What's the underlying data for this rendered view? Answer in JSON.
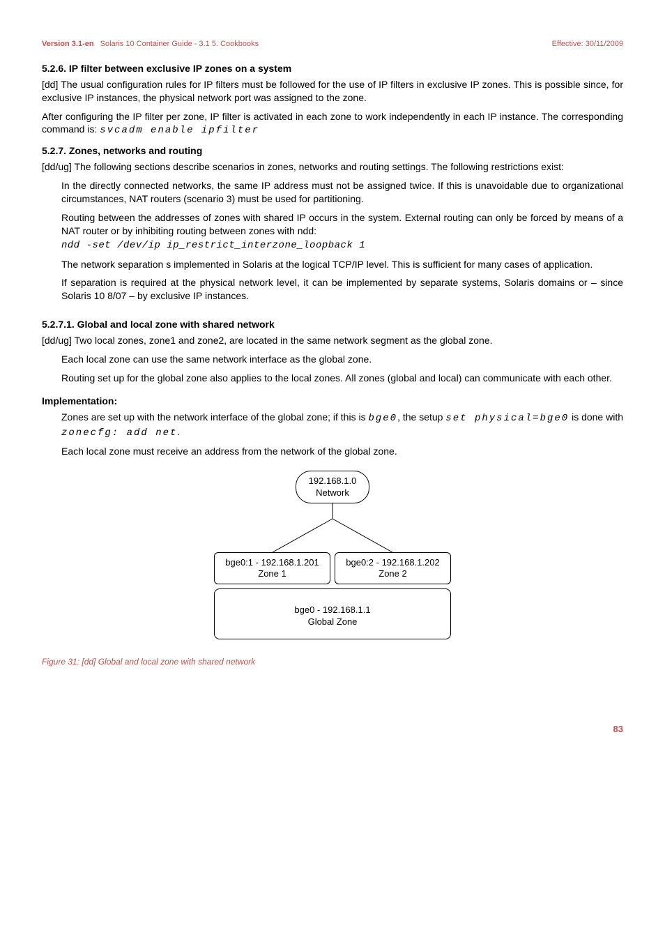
{
  "header": {
    "version": "Version 3.1-en",
    "title": "Solaris 10 Container Guide - 3.1   5. Cookbooks",
    "effective": "Effective: 30/11/2009"
  },
  "s526": {
    "heading": "5.2.6. IP filter between exclusive IP zones on a system",
    "p1": "[dd] The usual configuration rules for IP filters must be followed for the use of IP filters in exclusive IP zones. This is possible since, for exclusive IP instances, the physical network port was assigned to the zone.",
    "p2a": "After configuring the IP filter per zone, IP filter is activated in each zone to work independently in each IP instance. The corresponding command is: ",
    "p2b": "svcadm enable ipfilter"
  },
  "s527": {
    "heading": "5.2.7. Zones, networks and routing",
    "p1": "[dd/ug] The following sections describe scenarios in zones, networks and routing settings. The following restrictions exist:",
    "b1": "In the directly connected networks, the same IP address must not be assigned twice. If this is unavoidable due to organizational circumstances, NAT routers (scenario 3) must be used for partitioning.",
    "b2a": "Routing between the addresses of zones with shared IP occurs in the system. External routing can only be forced by means of a NAT router or by inhibiting routing between zones with ndd:",
    "b2b": "ndd -set /dev/ip ip_restrict_interzone_loopback 1",
    "b3": "The network separation s implemented in Solaris at the logical TCP/IP level. This is sufficient for many cases of application.",
    "b4": "If separation is required at the physical network level, it can be implemented by separate systems, Solaris domains or – since Solaris 10 8/07 – by exclusive IP instances."
  },
  "s5271": {
    "heading": "5.2.7.1. Global and local zone with shared network",
    "p1": "[dd/ug] Two local zones, zone1 and zone2, are located in the same network segment as the global zone.",
    "b1": "Each local zone can use the same network interface as the global zone.",
    "b2": "Routing set up for the global zone also applies to the local zones. All zones (global and local) can communicate with each other."
  },
  "impl": {
    "heading": "Implementation:",
    "b1a": "Zones are set up with the network interface of the global zone; if this is ",
    "b1b": "bge0",
    "b1c": ", the setup ",
    "b1d": "set physical=bge0",
    "b1e": " is done with ",
    "b1f": "zonecfg: add net",
    "b1g": ".",
    "b2": "Each local zone must receive an address from the network of the global zone."
  },
  "diagram": {
    "network_ip": "192.168.1.0",
    "network_label": "Network",
    "zone1_if": "bge0:1 - 192.168.1.201",
    "zone1_label": "Zone 1",
    "zone2_if": "bge0:2 - 192.168.1.202",
    "zone2_label": "Zone 2",
    "global_if": "bge0 - 192.168.1.1",
    "global_label": "Global Zone"
  },
  "figure_caption": "Figure 31: [dd] Global and local zone with shared network",
  "page_number": "83"
}
